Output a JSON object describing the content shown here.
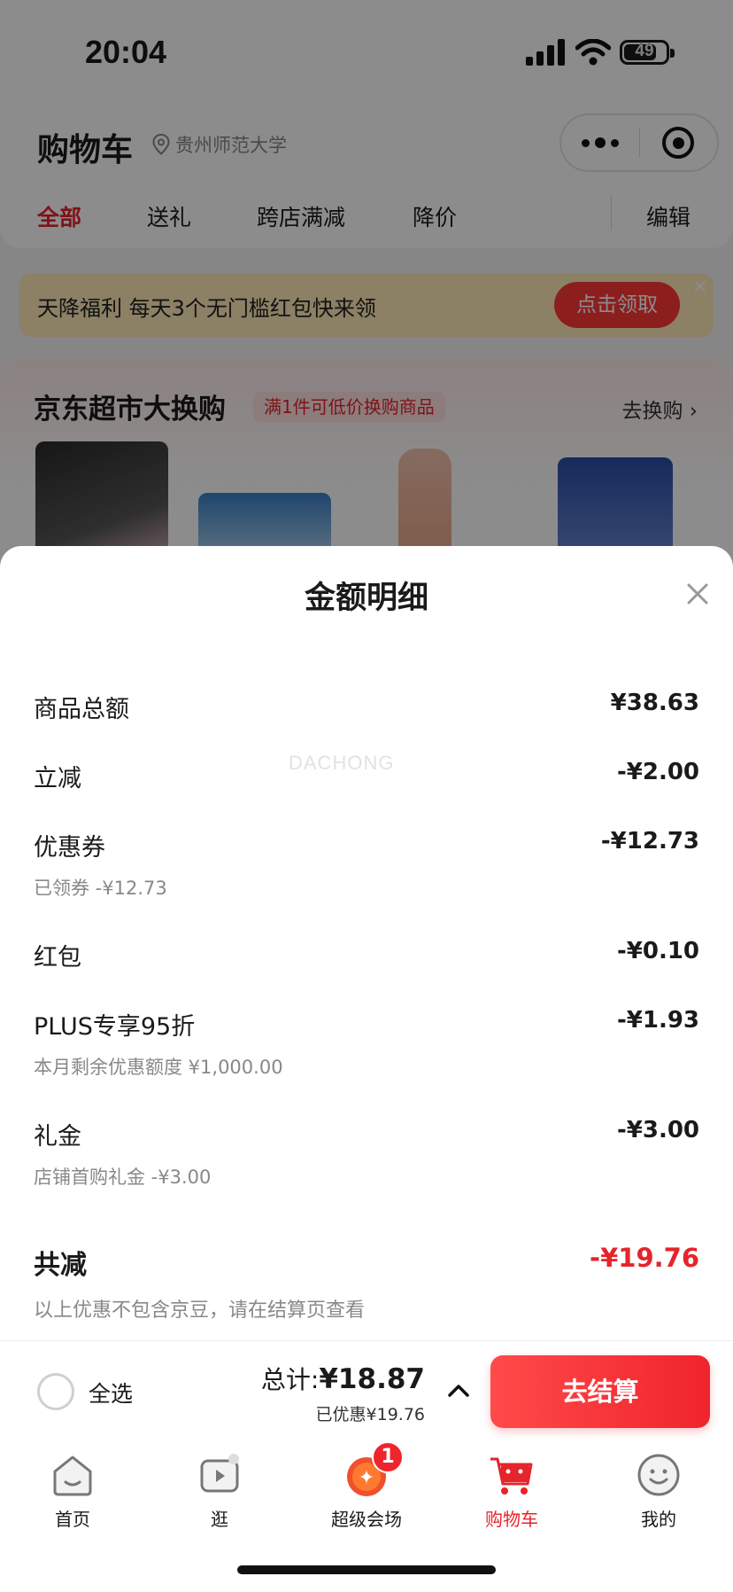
{
  "status_bar": {
    "time": "20:04",
    "battery": "49"
  },
  "header": {
    "title": "购物车",
    "location": "贵州师范大学",
    "tabs": [
      "全部",
      "送礼",
      "跨店满减",
      "降价"
    ],
    "edit_label": "编辑"
  },
  "promo_banner": {
    "text": "天降福利 每天3个无门槛红包快来领",
    "button": "点击领取"
  },
  "swap_section": {
    "title": "京东超市大换购",
    "tag": "满1件可低价换购商品",
    "link": "去换购 ›"
  },
  "sheet": {
    "title": "金额明细",
    "watermark": "DACHONG",
    "rows": [
      {
        "label": "商品总额",
        "value": "¥38.63"
      },
      {
        "label": "立减",
        "value": "-¥2.00"
      },
      {
        "label": "优惠券",
        "value": "-¥12.73",
        "sub": "已领券 -¥12.73"
      },
      {
        "label": "红包",
        "value": "-¥0.10"
      },
      {
        "label": "PLUS专享95折",
        "value": "-¥1.93",
        "sub": "本月剩余优惠额度 ¥1,000.00"
      },
      {
        "label": "礼金",
        "value": "-¥3.00",
        "sub": "店铺首购礼金 -¥3.00"
      }
    ],
    "total_label": "共减",
    "total_value": "-¥19.76",
    "note": "以上优惠不包含京豆，请在结算页查看"
  },
  "checkout": {
    "select_all": "全选",
    "total_prefix": "总计:",
    "total_amount": "¥18.87",
    "saved": "已优惠¥19.76",
    "pay_button": "去结算"
  },
  "nav": {
    "items": [
      {
        "label": "首页",
        "icon": "home-icon"
      },
      {
        "label": "逛",
        "icon": "video-icon"
      },
      {
        "label": "超级会场",
        "icon": "super-venue-icon",
        "badge": "1"
      },
      {
        "label": "购物车",
        "icon": "cart-icon",
        "active": true
      },
      {
        "label": "我的",
        "icon": "profile-icon"
      }
    ]
  },
  "colors": {
    "accent": "#e5242b",
    "promo_bg": "#ffe9b8",
    "overlay": "rgba(0,0,0,0.45)"
  }
}
